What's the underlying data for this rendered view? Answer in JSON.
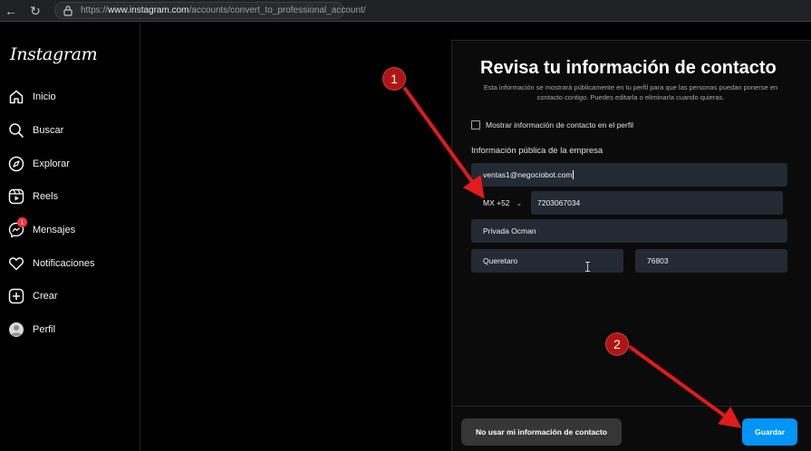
{
  "browser": {
    "url_prefix": "https://",
    "url_domain": "www.instagram.com",
    "url_path": "/accounts/convert_to_professional_account/"
  },
  "sidebar": {
    "logo": "Instagram",
    "items": [
      {
        "label": "Inicio",
        "icon": "home-icon"
      },
      {
        "label": "Buscar",
        "icon": "search-icon"
      },
      {
        "label": "Explorar",
        "icon": "compass-icon"
      },
      {
        "label": "Reels",
        "icon": "reels-icon"
      },
      {
        "label": "Mensajes",
        "icon": "messenger-icon",
        "badge": "1"
      },
      {
        "label": "Notificaciones",
        "icon": "heart-icon"
      },
      {
        "label": "Crear",
        "icon": "plus-square-icon"
      },
      {
        "label": "Perfil",
        "icon": "avatar-icon"
      }
    ]
  },
  "dialog": {
    "title": "Revisa tu información de contacto",
    "subtitle": "Esta información se mostrará públicamente en tu perfil para que las personas puedan ponerse en contacto contigo. Puedes editarla o eliminarla cuando quieras.",
    "show_contact_label": "Mostrar información de contacto en el perfil",
    "show_contact_checked": false,
    "section_label": "Información pública de la empresa",
    "email": "ventas1@negociobot.com",
    "country_code": "MX +52",
    "phone": "7203067034",
    "address": "Privada Ocman",
    "city": "Queretaro",
    "zip": "76803",
    "skip_button": "No usar mi información de contacto",
    "save_button": "Guardar"
  },
  "annotations": [
    {
      "number": "1"
    },
    {
      "number": "2"
    }
  ],
  "colors": {
    "background": "#000000",
    "field_bg": "#232a34",
    "primary": "#0095f6",
    "secondary_button": "#363636",
    "annotation_red": "#e21b1b",
    "badge_red": "#ff3040"
  }
}
